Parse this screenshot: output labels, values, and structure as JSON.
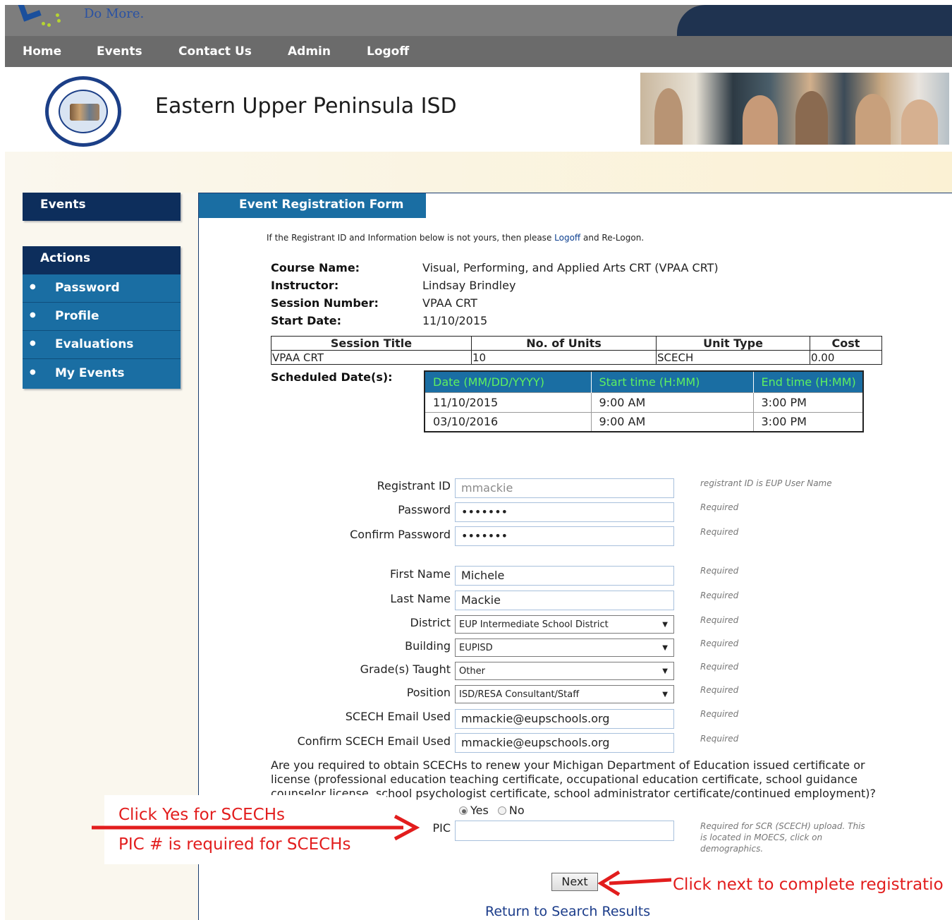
{
  "banner": {
    "tagline": "Do More."
  },
  "nav": [
    "Home",
    "Events",
    "Contact Us",
    "Admin",
    "Logoff"
  ],
  "header": {
    "title": "Eastern Upper Peninsula ISD"
  },
  "sidebar": {
    "events_label": "Events",
    "actions_label": "Actions",
    "items": [
      {
        "label": "Password"
      },
      {
        "label": "Profile"
      },
      {
        "label": "Evaluations"
      },
      {
        "label": "My Events"
      }
    ]
  },
  "form": {
    "tab_title": "Event Registration Form",
    "notice_pre": "If the Registrant ID and Information below is not yours, then please",
    "notice_link": "Logoff",
    "notice_post": "and Re-Logon."
  },
  "course": {
    "name_label": "Course Name:",
    "name": "Visual, Performing, and Applied Arts CRT (VPAA CRT)",
    "instructor_label": "Instructor:",
    "instructor": "Lindsay Brindley",
    "session_label": "Session Number:",
    "session": "VPAA CRT",
    "start_label": "Start Date:",
    "start": "11/10/2015"
  },
  "session_table": {
    "headers": [
      "Session Title",
      "No. of Units",
      "Unit Type",
      "Cost"
    ],
    "row": [
      "VPAA CRT",
      "10",
      "SCECH",
      "0.00"
    ]
  },
  "schedule": {
    "label": "Scheduled Date(s):",
    "headers": [
      "Date (MM/DD/YYYY)",
      "Start time (H:MM)",
      "End time (H:MM)"
    ],
    "rows": [
      [
        "11/10/2015",
        "9:00 AM",
        "3:00 PM"
      ],
      [
        "03/10/2016",
        "9:00 AM",
        "3:00 PM"
      ]
    ]
  },
  "fields": {
    "registrant_id": {
      "label": "Registrant ID",
      "value": "mmackie",
      "hint": "registrant ID is EUP User Name"
    },
    "password": {
      "label": "Password",
      "value": "•••••••",
      "hint": "Required"
    },
    "confirm_password": {
      "label": "Confirm Password",
      "value": "•••••••",
      "hint": "Required"
    },
    "first_name": {
      "label": "First Name",
      "value": "Michele",
      "hint": "Required"
    },
    "last_name": {
      "label": "Last Name",
      "value": "Mackie",
      "hint": "Required"
    },
    "district": {
      "label": "District",
      "value": "EUP Intermediate School District",
      "hint": "Required"
    },
    "building": {
      "label": "Building",
      "value": "EUPISD",
      "hint": "Required"
    },
    "grades": {
      "label": "Grade(s) Taught",
      "value": "Other",
      "hint": "Required"
    },
    "position": {
      "label": "Position",
      "value": "ISD/RESA Consultant/Staff",
      "hint": "Required"
    },
    "scech_email": {
      "label": "SCECH Email Used",
      "value": "mmackie@eupschools.org",
      "hint": "Required"
    },
    "confirm_scech_email": {
      "label": "Confirm SCECH Email Used",
      "value": "mmackie@eupschools.org",
      "hint": "Required"
    },
    "pic": {
      "label": "PIC",
      "value": "",
      "hint1": "Required for SCR (SCECH) upload. This",
      "hint2": "is located in MOECS, click on",
      "hint3": "demographics."
    }
  },
  "question": {
    "line1": "Are you required to obtain SCECHs to renew your Michigan Department of Education issued certificate or",
    "line2": "license (professional education teaching certificate, occupational education certificate, school guidance",
    "line3": "counselor license, school psychologist certificate, school administrator certificate/continued employment)?",
    "yes": "Yes",
    "no": "No",
    "selected": "Yes"
  },
  "annotations": {
    "yes_note": "Click Yes for SCECHs",
    "pic_note": "PIC # is required for SCECHs",
    "next_note": "Click next to complete registratio",
    "color": "#e21d1d"
  },
  "actions": {
    "next": "Next",
    "return": "Return to Search Results"
  }
}
